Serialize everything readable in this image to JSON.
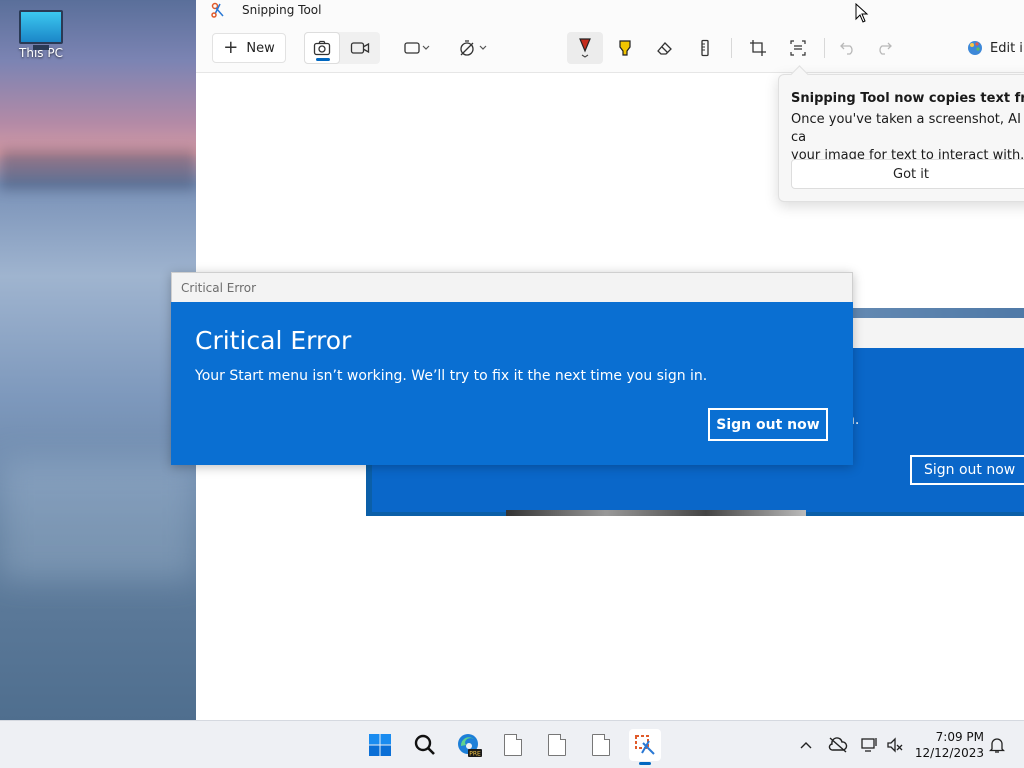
{
  "desktop": {
    "icon_label": "This PC"
  },
  "window": {
    "title": "Snipping Tool"
  },
  "toolbar": {
    "new_label": "New",
    "edit_label": "Edit i"
  },
  "tip": {
    "title": "Snipping Tool now copies text from i",
    "body_line1": "Once you've taken a screenshot, AI ca",
    "body_line2": "your image for text to interact with.",
    "button": "Got it"
  },
  "background_copy": {
    "partial_text": "n.",
    "signout_label": "Sign out now"
  },
  "dialog": {
    "title": "Critical Error",
    "heading": "Critical Error",
    "message": "Your Start menu isn’t working. We’ll try to fix it the next time you sign in.",
    "button": "Sign out now"
  },
  "taskbar": {
    "time": "7:09 PM",
    "date": "12/12/2023",
    "edge_badge": "PRE"
  },
  "colors": {
    "accent": "#0067c0",
    "dialog_blue": "#0a6fd2",
    "marker_red": "#c42b1c",
    "highlighter_yellow": "#f2c500"
  }
}
